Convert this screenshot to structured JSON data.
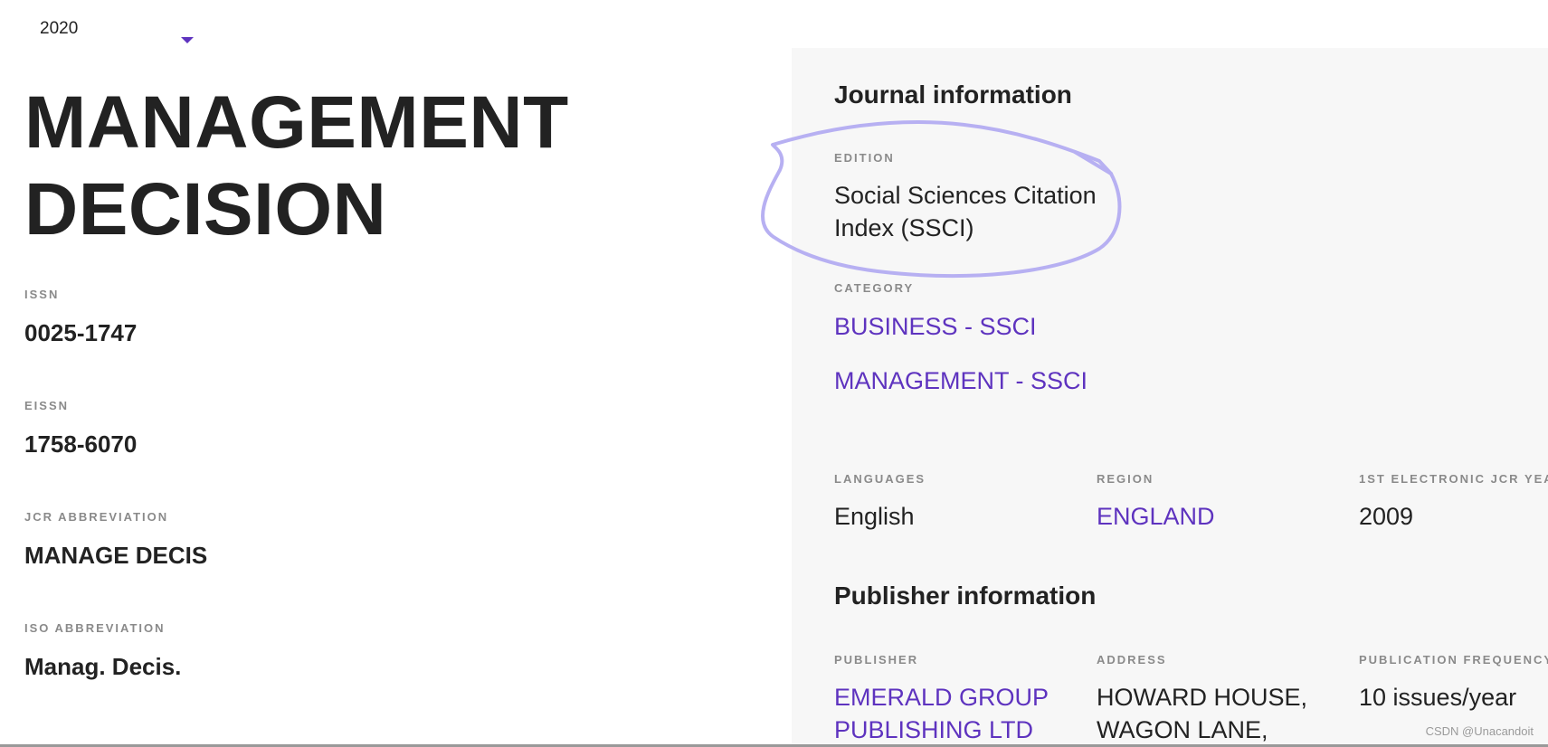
{
  "year_select": {
    "value": "2020"
  },
  "journal": {
    "title_line1": "MANAGEMENT",
    "title_line2": "DECISION",
    "fields": [
      {
        "label": "ISSN",
        "value": "0025-1747"
      },
      {
        "label": "EISSN",
        "value": "1758-6070"
      },
      {
        "label": "JCR ABBREVIATION",
        "value": "MANAGE DECIS"
      },
      {
        "label": "ISO ABBREVIATION",
        "value": "Manag. Decis."
      }
    ]
  },
  "journal_info": {
    "title": "Journal information",
    "edition_label": "EDITION",
    "edition_value": "Social Sciences Citation Index (SSCI)",
    "category_label": "CATEGORY",
    "categories": [
      "BUSINESS - SSCI",
      "MANAGEMENT - SSCI"
    ],
    "languages_label": "LANGUAGES",
    "languages_value": "English",
    "region_label": "REGION",
    "region_value": "ENGLAND",
    "first_year_label": "1ST ELECTRONIC JCR YEA",
    "first_year_value": "2009"
  },
  "publisher_info": {
    "title": "Publisher information",
    "publisher_label": "PUBLISHER",
    "publisher_value": "EMERALD GROUP PUBLISHING LTD",
    "address_label": "ADDRESS",
    "address_value": "HOWARD HOUSE, WAGON LANE,",
    "frequency_label": "PUBLICATION FREQUENCY",
    "frequency_value": "10 issues/year"
  },
  "watermark": "CSDN @Unacandoit",
  "colors": {
    "accent": "#5e33bf",
    "panel_bg": "#f7f7f7",
    "annotation": "#b7b0f2"
  },
  "icons": {
    "dropdown": "caret-down-icon"
  }
}
